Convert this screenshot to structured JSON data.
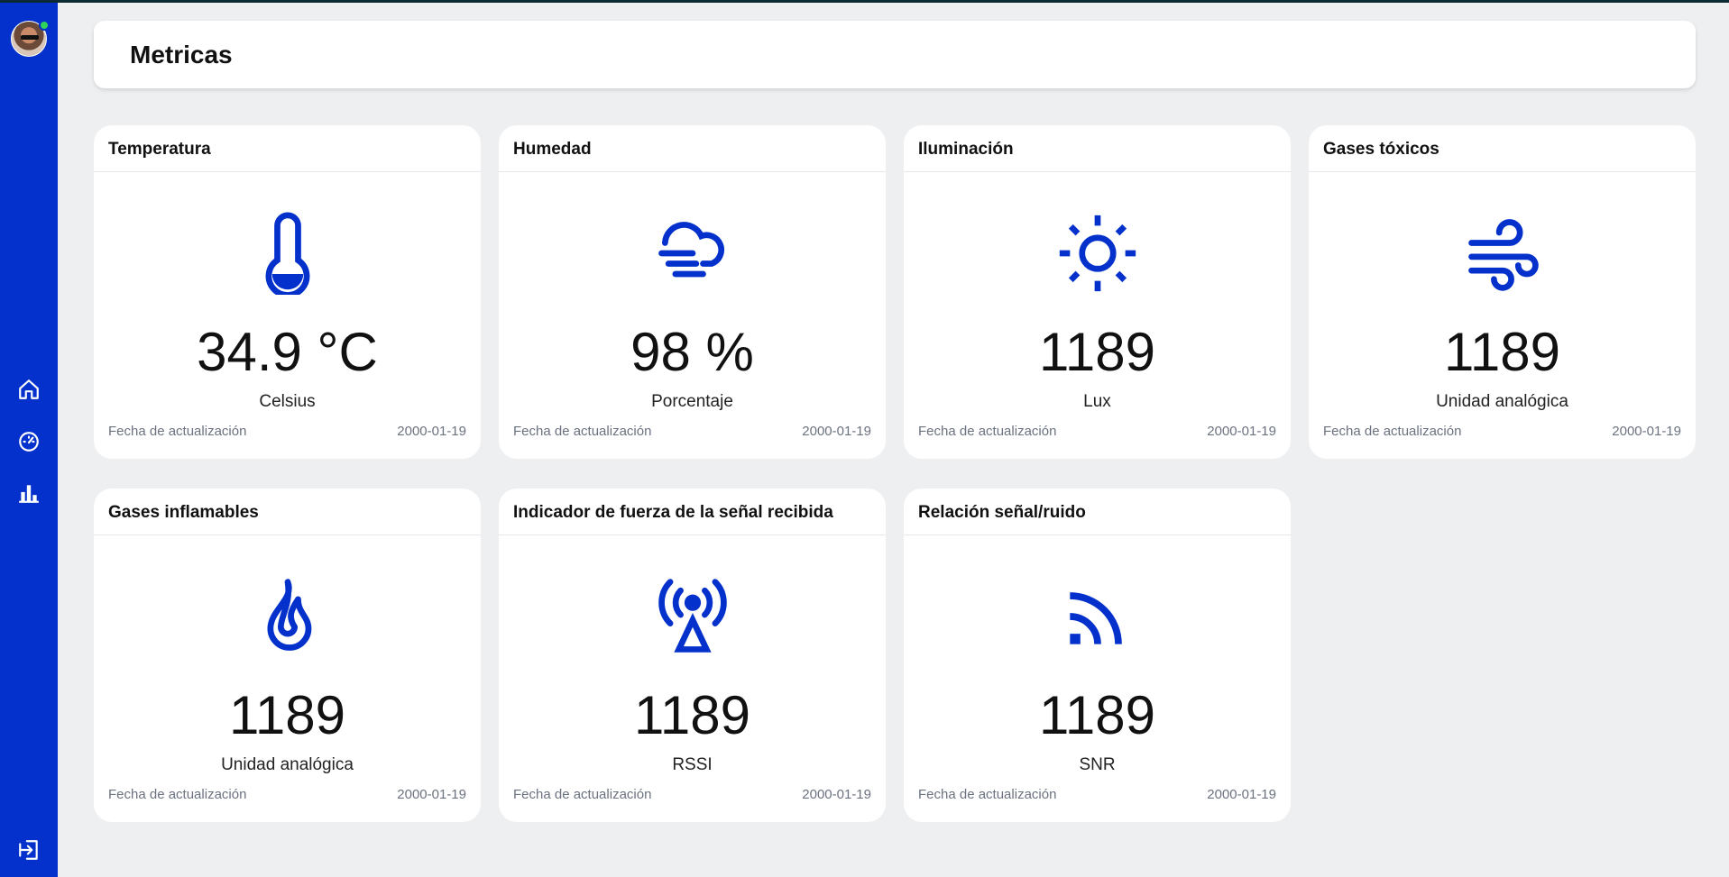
{
  "page": {
    "title": "Metricas"
  },
  "colors": {
    "accent": "#0431cc",
    "background": "#eeeff1",
    "online": "#2fd15a"
  },
  "sidebar": {
    "nav": [
      {
        "name": "home-icon"
      },
      {
        "name": "gauge-icon"
      },
      {
        "name": "bar-chart-icon"
      }
    ],
    "logout_icon": "logout-icon"
  },
  "cards": [
    {
      "title": "Temperatura",
      "icon": "thermometer-icon",
      "value": "34.9 °C",
      "unit": "Celsius",
      "updated_label": "Fecha de actualización",
      "updated_date": "2000-01-19"
    },
    {
      "title": "Humedad",
      "icon": "fog-cloud-icon",
      "value": "98 %",
      "unit": "Porcentaje",
      "updated_label": "Fecha de actualización",
      "updated_date": "2000-01-19"
    },
    {
      "title": "Iluminación",
      "icon": "sun-icon",
      "value": "1189",
      "unit": "Lux",
      "updated_label": "Fecha de actualización",
      "updated_date": "2000-01-19"
    },
    {
      "title": "Gases tóxicos",
      "icon": "wind-icon",
      "value": "1189",
      "unit": "Unidad analógica",
      "updated_label": "Fecha de actualización",
      "updated_date": "2000-01-19"
    },
    {
      "title": "Gases inflamables",
      "icon": "flame-icon",
      "value": "1189",
      "unit": "Unidad analógica",
      "updated_label": "Fecha de actualización",
      "updated_date": "2000-01-19"
    },
    {
      "title": "Indicador de fuerza de la señal recibida",
      "icon": "antenna-icon",
      "value": "1189",
      "unit": "RSSI",
      "updated_label": "Fecha de actualización",
      "updated_date": "2000-01-19"
    },
    {
      "title": "Relación señal/ruido",
      "icon": "signal-icon",
      "value": "1189",
      "unit": "SNR",
      "updated_label": "Fecha de actualización",
      "updated_date": "2000-01-19"
    }
  ]
}
